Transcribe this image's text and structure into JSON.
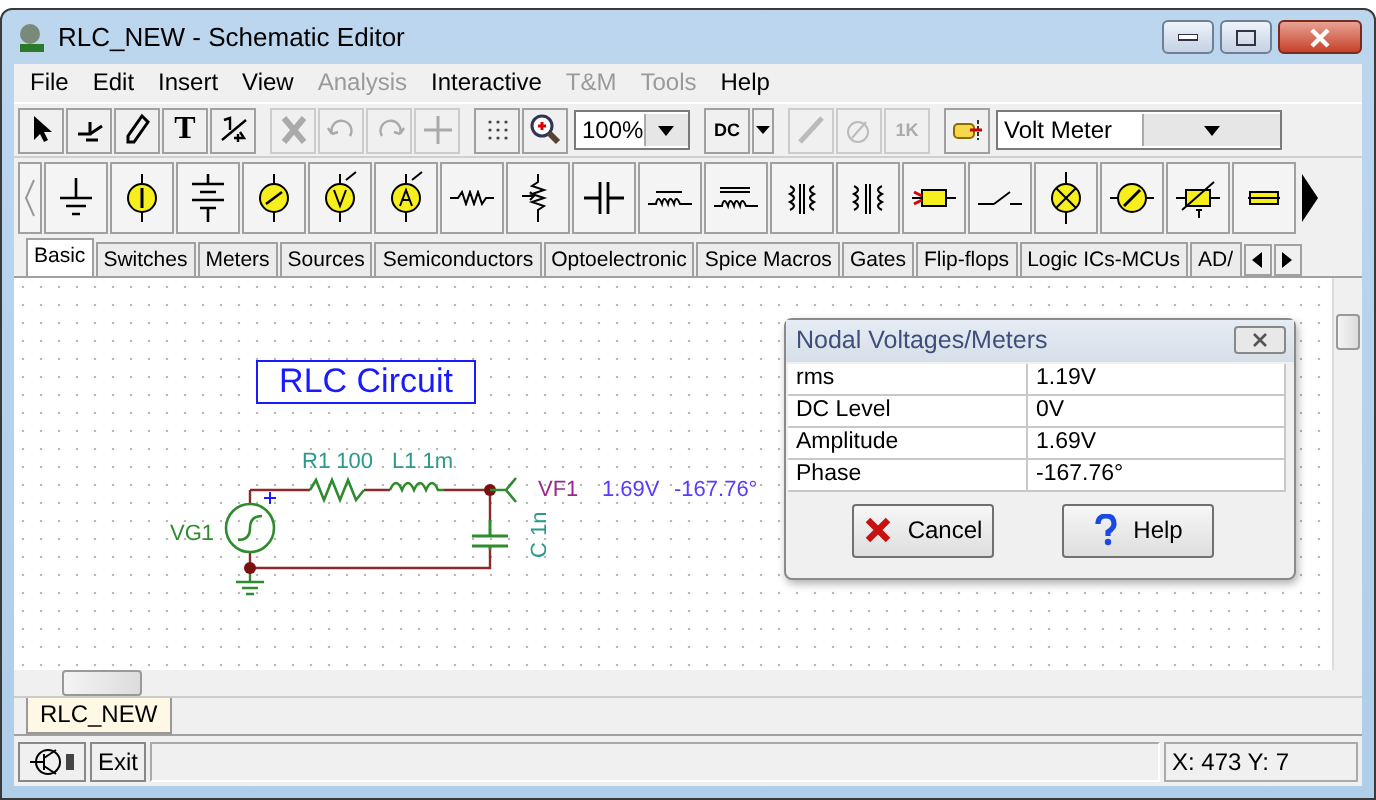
{
  "window": {
    "title": "RLC_NEW - Schematic Editor"
  },
  "menu": [
    {
      "label": "File",
      "disabled": false
    },
    {
      "label": "Edit",
      "disabled": false
    },
    {
      "label": "Insert",
      "disabled": false
    },
    {
      "label": "View",
      "disabled": false
    },
    {
      "label": "Analysis",
      "disabled": true
    },
    {
      "label": "Interactive",
      "disabled": false
    },
    {
      "label": "T&M",
      "disabled": true
    },
    {
      "label": "Tools",
      "disabled": true
    },
    {
      "label": "Help",
      "disabled": false
    }
  ],
  "toolbar": [
    {
      "kind": "button",
      "disabled": false
    },
    {
      "kind": "button",
      "disabled": false
    },
    {
      "kind": "button",
      "disabled": false
    },
    {
      "kind": "button",
      "label": "T",
      "disabled": false
    },
    {
      "kind": "button",
      "disabled": false
    },
    {
      "kind": "button",
      "disabled": true
    },
    {
      "kind": "button",
      "disabled": true
    },
    {
      "kind": "button",
      "disabled": true
    },
    {
      "kind": "button",
      "disabled": true
    },
    {
      "kind": "button",
      "disabled": false
    },
    {
      "kind": "button",
      "disabled": false
    },
    {
      "kind": "combo",
      "value": "100%"
    },
    {
      "kind": "button",
      "label": "DC",
      "disabled": false
    },
    {
      "kind": "dropdown",
      "disabled": false
    },
    {
      "kind": "button",
      "disabled": true
    },
    {
      "kind": "button",
      "disabled": true
    },
    {
      "kind": "button",
      "label": "1K",
      "disabled": true
    },
    {
      "kind": "button",
      "disabled": false
    },
    {
      "kind": "combo",
      "value": "Volt Meter"
    }
  ],
  "tabs": [
    {
      "label": "Basic",
      "selected": true
    },
    {
      "label": "Switches",
      "selected": false
    },
    {
      "label": "Meters",
      "selected": false
    },
    {
      "label": "Sources",
      "selected": false
    },
    {
      "label": "Semiconductors",
      "selected": false
    },
    {
      "label": "Optoelectronic",
      "selected": false
    },
    {
      "label": "Spice Macros",
      "selected": false
    },
    {
      "label": "Gates",
      "selected": false
    },
    {
      "label": "Flip-flops",
      "selected": false
    },
    {
      "label": "Logic ICs-MCUs",
      "selected": false
    },
    {
      "label": "AD/",
      "selected": false
    }
  ],
  "schematic": {
    "title": "RLC Circuit",
    "r1": "R1 100",
    "l1": "L1 1m",
    "source": "VG1",
    "c1": "C 1n",
    "probe": "VF1",
    "probe_value": "1.69V",
    "probe_phase": "-167.76°"
  },
  "dialog": {
    "title": "Nodal Voltages/Meters",
    "rows": [
      {
        "name": "rms",
        "value": "1.19V"
      },
      {
        "name": "DC Level",
        "value": "0V"
      },
      {
        "name": "Amplitude",
        "value": "1.69V"
      },
      {
        "name": "Phase",
        "value": "-167.76°"
      }
    ],
    "buttons": [
      "Cancel",
      "Help"
    ]
  },
  "document_tabs": [
    {
      "label": "RLC_NEW",
      "selected": true
    }
  ],
  "status_bar": {
    "exit": "Exit",
    "coordinates": "X: 473 Y: 7"
  }
}
